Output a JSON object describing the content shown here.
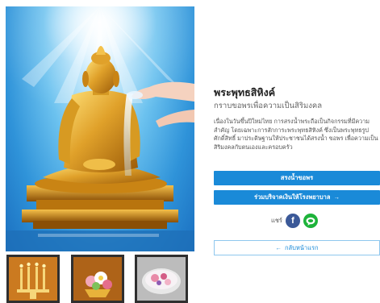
{
  "hero": {
    "image": "golden-buddha-statue-bathing"
  },
  "thumbnails": [
    {
      "image": "golden-candelabra"
    },
    {
      "image": "flower-offering-tray"
    },
    {
      "image": "floral-water-bowl"
    }
  ],
  "product": {
    "title": "พระพุทธสิหิงค์",
    "subtitle": "กราบขอพรเพื่อความเป็นสิริมงคล",
    "description": "เนื่องในวันขึ้นปีใหม่ไทย การสรงน้ำพระถือเป็นกิจกรรมที่มีความสำคัญ โดยเฉพาะการสักการะพระพุทธสิหิงค์ ซึ่งเป็นพระพุทธรูปศักดิ์สิทธิ์ มาประดิษฐานให้ประชาชนได้สรงน้ำ ขอพร เพื่อความเป็นสิริมงคลกับตนเองและครอบครัว"
  },
  "actions": {
    "primary": "สรงน้ำขอพร",
    "secondary": "ร่วมบริจาคเงินให้โรงพยาบาล",
    "secondary_arrow": "→",
    "back": "กลับหน้าแรก",
    "back_arrow": "←"
  },
  "share": {
    "label": "แชร์",
    "facebook": "f"
  },
  "colors": {
    "primary": "#1a8ad8",
    "facebook": "#3b5998",
    "line": "#1db33a"
  }
}
